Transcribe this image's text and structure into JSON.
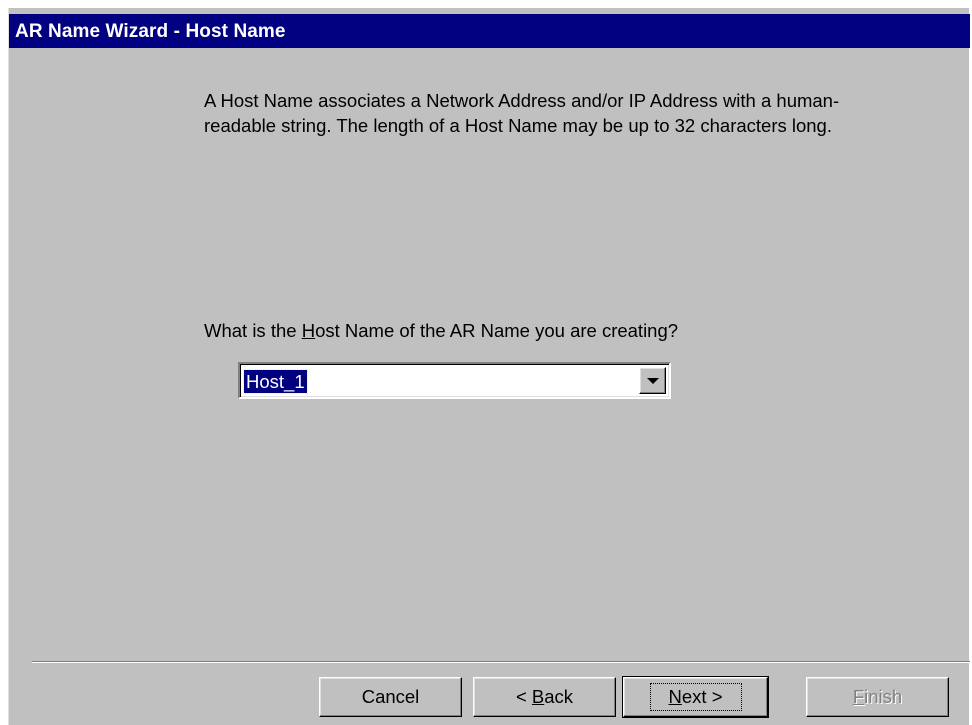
{
  "window": {
    "title": "AR Name Wizard - Host Name"
  },
  "main": {
    "description": "A Host Name associates a Network Address and/or IP Address with a human-readable string. The length of a Host Name may be up to 32 characters long.",
    "question_prefix": "What is the ",
    "question_hotkey": "H",
    "question_suffix": "ost Name of the AR Name you are creating?",
    "host_name_combo": {
      "value": "Host_1",
      "icon": "chevron-down-icon"
    }
  },
  "footer": {
    "cancel_label": "Cancel",
    "back_prefix": "< ",
    "back_hotkey": "B",
    "back_suffix": "ack",
    "next_hotkey": "N",
    "next_suffix": "ext >",
    "finish_hotkey": "F",
    "finish_suffix": "inish"
  },
  "colors": {
    "titlebar": "#000080",
    "dialog_face": "#c0c0c0",
    "selection": "#000080",
    "disabled_text": "#808080"
  }
}
